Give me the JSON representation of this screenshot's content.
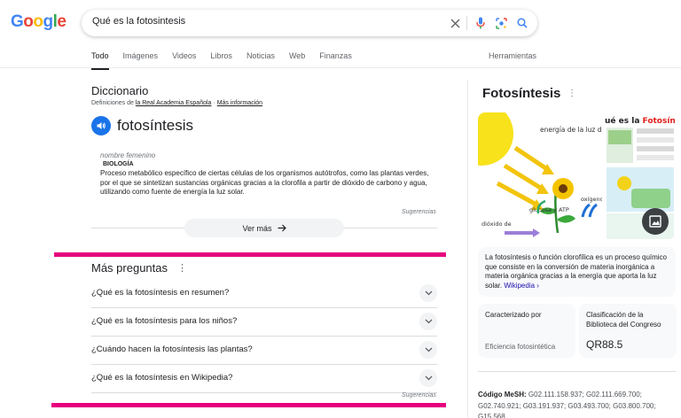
{
  "logo": {
    "letters": [
      "G",
      "o",
      "o",
      "g",
      "l",
      "e"
    ],
    "colors": [
      "#4285f4",
      "#ea4335",
      "#fbbc05",
      "#4285f4",
      "#34a853",
      "#ea4335"
    ]
  },
  "search": {
    "query": "Qué es la fotosintesis",
    "icons": [
      "close-icon",
      "mic-icon",
      "lens-icon",
      "search-icon"
    ]
  },
  "tabs": [
    "Todo",
    "Imágenes",
    "Videos",
    "Libros",
    "Noticias",
    "Web",
    "Finanzas"
  ],
  "tools_label": "Herramientas",
  "dictionary": {
    "title": "Diccionario",
    "source_prefix": "Definiciones de",
    "source_link": "la Real Academia Española",
    "source_sep": " · ",
    "more_info": "Más información",
    "word": "fotosíntesis",
    "grammar": "nombre femenino",
    "field": "BIOLOGÍA",
    "definition": "Proceso metabólico específico de ciertas células de los organismos autótrofos, como las plantas verdes, por el que se sintetizan sustancias orgánicas gracias a la clorofila a partir de dióxido de carbono y agua, utilizando como fuente de energía la luz solar.",
    "suggestions": "Sugerencias",
    "see_more": "Ver más"
  },
  "more_questions": {
    "title": "Más preguntas",
    "items": [
      "¿Qué es la fotosíntesis en resumen?",
      "¿Qué es la fotosíntesis para los niños?",
      "¿Cuándo hacen la fotosíntesis las plantas?",
      "¿Qué es la fotosíntesis en Wikipedia?"
    ],
    "suggestions": "Sugerencias"
  },
  "knowledge_panel": {
    "title": "Fotosíntesis",
    "image_labels": {
      "energy": "energía de la luz del Sol",
      "oxygen": "oxígeno",
      "glucose": "glucosa y ATP",
      "co2": "dióxido de",
      "header_plain": "ué es la ",
      "header_red": "Fotosínte"
    },
    "description": "La fotosíntesis o función clorofílica es un proceso químico que consiste en la conversión de materia inorgánica a materia orgánica gracias a la energía que aporta la luz solar.",
    "wiki_link": "Wikipedia",
    "cards": [
      {
        "label": "Caracterizado por",
        "value": "Eficiencia fotosintética"
      },
      {
        "label": "Clasificación de la Biblioteca del Congreso",
        "value": "QR88.5"
      }
    ],
    "mesh_label": "Código MeSH:",
    "mesh_value": "G02.111.158.937; G02.111.669.700; G02.740.921; G03.191.937; G03.493.700; G03.800.700; G15.568"
  }
}
